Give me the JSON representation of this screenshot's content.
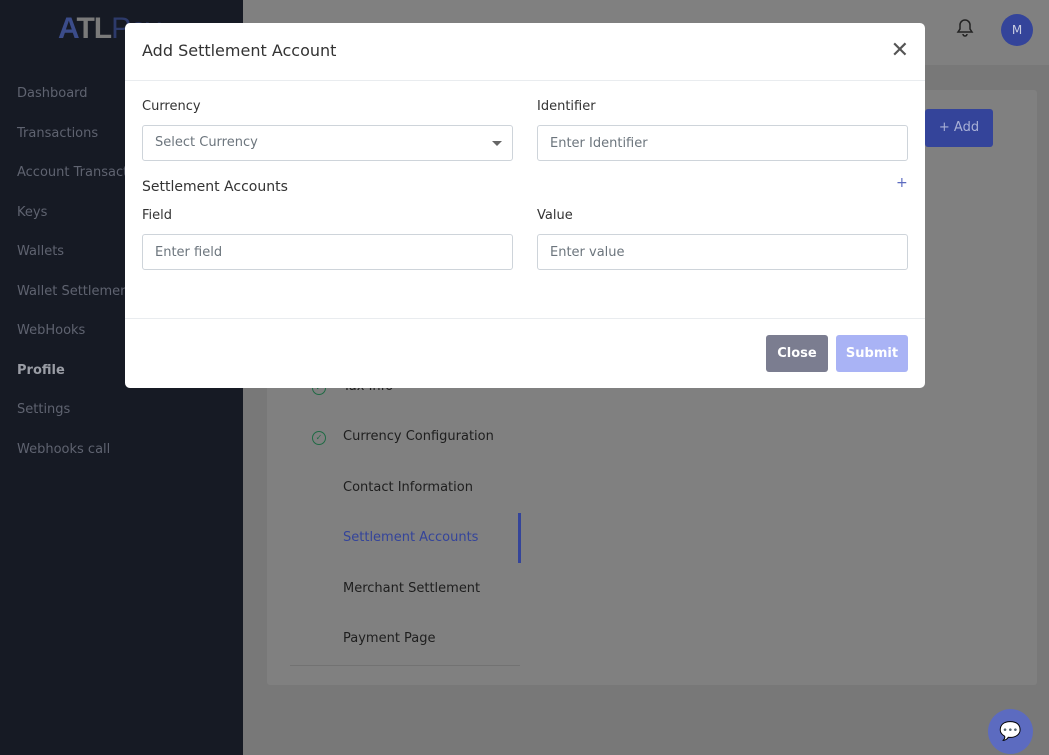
{
  "brand": {
    "logo_text": "ATLPay"
  },
  "sidebar": {
    "items": [
      {
        "label": "Dashboard"
      },
      {
        "label": "Transactions"
      },
      {
        "label": "Account Transactions"
      },
      {
        "label": "Keys"
      },
      {
        "label": "Wallets"
      },
      {
        "label": "Wallet Settlement"
      },
      {
        "label": "WebHooks"
      },
      {
        "label": "Profile",
        "active": true
      },
      {
        "label": "Settings"
      },
      {
        "label": "Webhooks call"
      }
    ]
  },
  "header": {
    "avatar_initial": "M",
    "add_label": "+ Add"
  },
  "steps": [
    {
      "label": "Tax Info",
      "done": true
    },
    {
      "label": "Currency Configuration",
      "done": true
    },
    {
      "label": "Contact Information"
    },
    {
      "label": "Settlement Accounts",
      "selected": true
    },
    {
      "label": "Merchant Settlement"
    },
    {
      "label": "Payment Page"
    }
  ],
  "modal": {
    "title": "Add Settlement Account",
    "currency_label": "Currency",
    "currency_placeholder": "Select Currency",
    "identifier_label": "Identifier",
    "identifier_placeholder": "Enter Identifier",
    "section_title": "Settlement Accounts",
    "field_label": "Field",
    "field_placeholder": "Enter field",
    "value_label": "Value",
    "value_placeholder": "Enter value",
    "close_label": "Close",
    "submit_label": "Submit"
  },
  "colors": {
    "accent": "#5c6bc0",
    "submit_disabled": "#a9b3f5",
    "close": "#7b7d90"
  }
}
